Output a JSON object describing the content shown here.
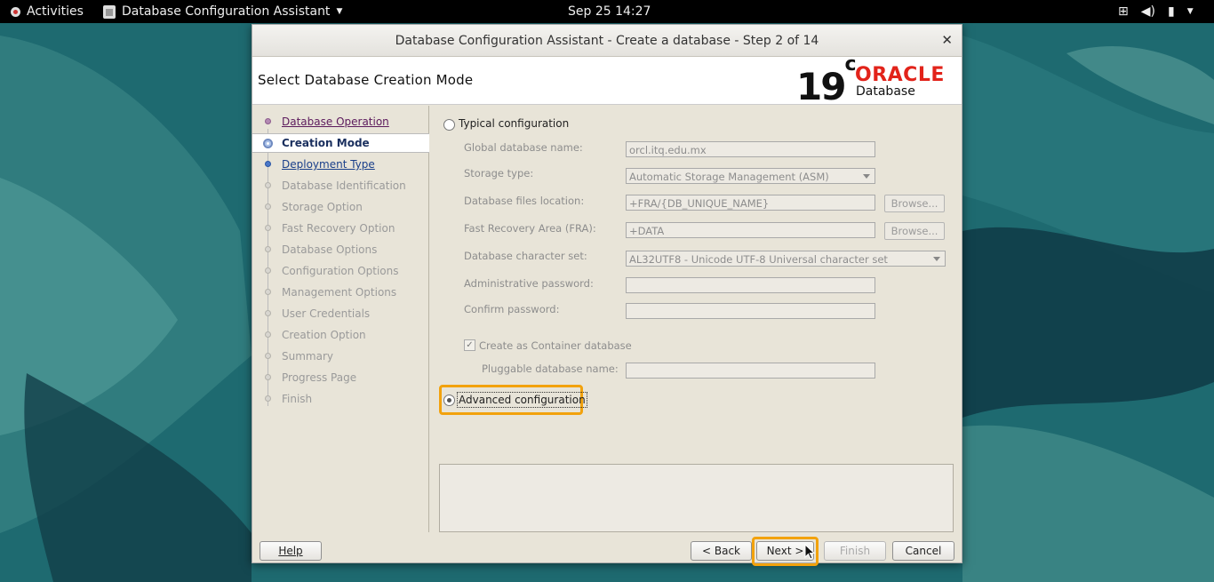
{
  "topbar": {
    "activities": "Activities",
    "app_name": "Database Configuration Assistant",
    "datetime": "Sep 25  14:27"
  },
  "dialog": {
    "title": "Database Configuration Assistant - Create a database - Step 2 of 14",
    "header": "Select Database Creation Mode",
    "logo": {
      "version": "19",
      "version_sup": "c",
      "brand": "ORACLE",
      "product": "Database",
      "brand_color": "#e2231a"
    }
  },
  "nav": {
    "steps": [
      {
        "label": "Database Operation",
        "state": "done"
      },
      {
        "label": "Creation Mode",
        "state": "current"
      },
      {
        "label": "Deployment Type",
        "state": "link"
      },
      {
        "label": "Database Identification",
        "state": "disabled"
      },
      {
        "label": "Storage Option",
        "state": "disabled"
      },
      {
        "label": "Fast Recovery Option",
        "state": "disabled"
      },
      {
        "label": "Database Options",
        "state": "disabled"
      },
      {
        "label": "Configuration Options",
        "state": "disabled"
      },
      {
        "label": "Management Options",
        "state": "disabled"
      },
      {
        "label": "User Credentials",
        "state": "disabled"
      },
      {
        "label": "Creation Option",
        "state": "disabled"
      },
      {
        "label": "Summary",
        "state": "disabled"
      },
      {
        "label": "Progress Page",
        "state": "disabled"
      },
      {
        "label": "Finish",
        "state": "disabled"
      }
    ]
  },
  "form": {
    "typical_label": "Typical configuration",
    "typical_selected": false,
    "global_db_name_label": "Global database name:",
    "global_db_name_value": "orcl.itq.edu.mx",
    "storage_type_label": "Storage type:",
    "storage_type_value": "Automatic Storage Management (ASM)",
    "db_files_location_label": "Database files location:",
    "db_files_location_value": "+FRA/{DB_UNIQUE_NAME}",
    "fra_label": "Fast Recovery Area (FRA):",
    "fra_value": "+DATA",
    "browse_label": "Browse...",
    "charset_label": "Database character set:",
    "charset_value": "AL32UTF8 - Unicode UTF-8 Universal character set",
    "admin_password_label": "Administrative password:",
    "admin_password_value": "",
    "confirm_password_label": "Confirm password:",
    "confirm_password_value": "",
    "container_label": "Create as Container database",
    "container_checked": true,
    "pluggable_label": "Pluggable database name:",
    "pluggable_value": "",
    "advanced_label": "Advanced configuration",
    "advanced_selected": true,
    "highlight_color": "#f2a20d"
  },
  "buttons": {
    "help": "Help",
    "back": "< Back",
    "next": "Next >",
    "finish": "Finish",
    "cancel": "Cancel"
  }
}
